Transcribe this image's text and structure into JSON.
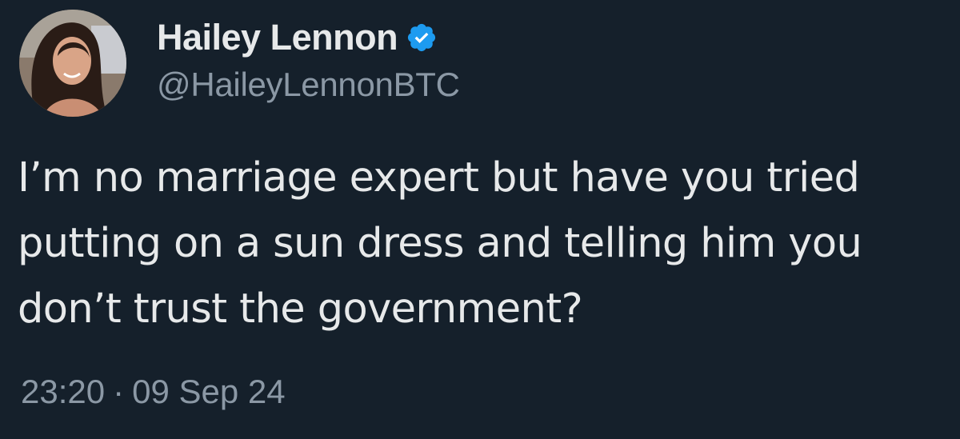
{
  "author": {
    "display_name": "Hailey Lennon",
    "handle": "@HaileyLennonBTC",
    "verified_icon": "verified-badge-icon",
    "badge_color": "#1d9bf0"
  },
  "tweet": {
    "lines": [
      "I’m no marriage expert but have you tried",
      "putting on a sun dress and telling him you",
      "don’t trust the government?"
    ]
  },
  "meta": {
    "time": "23:20",
    "separator": "·",
    "date": "09 Sep 24"
  },
  "colors": {
    "background": "#15202b",
    "primary_text": "#e7e9ea",
    "secondary_text": "#8b98a5"
  }
}
